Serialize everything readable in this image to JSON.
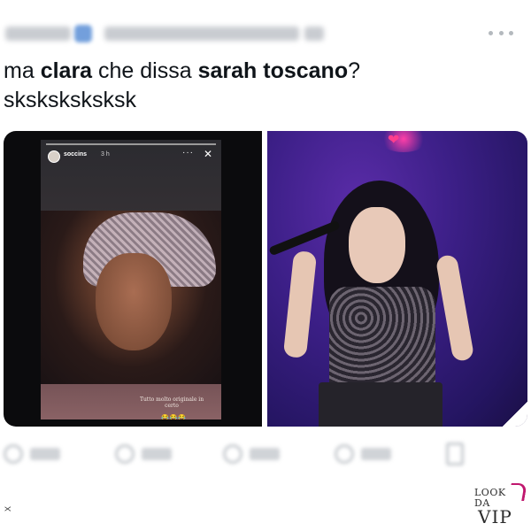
{
  "tweet": {
    "text_segments": [
      {
        "text": "ma ",
        "bold": false
      },
      {
        "text": "clara",
        "bold": true
      },
      {
        "text": " che dissa ",
        "bold": false
      },
      {
        "text": "sarah toscano",
        "bold": true
      },
      {
        "text": "?",
        "bold": false
      }
    ],
    "line2": "sksksksksksk"
  },
  "story": {
    "username": "soccins",
    "time": "3 h",
    "more": "···",
    "close": "✕",
    "caption": "Tutto molto originale in certo",
    "emoji": "😂😂😂"
  },
  "icons": {
    "more": "more-horizontal-icon",
    "reply": "reply-icon",
    "retweet": "retweet-icon",
    "like": "heart-icon",
    "views": "views-icon",
    "bookmark": "bookmark-icon"
  },
  "watermark": {
    "line1": "LOOK",
    "line2": "DA",
    "line3": "VIP"
  },
  "side_mark": "X"
}
